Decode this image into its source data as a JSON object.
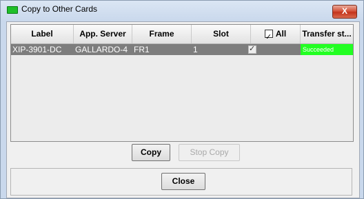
{
  "window": {
    "title": "Copy to Other Cards",
    "close_glyph": "X"
  },
  "table": {
    "columns": [
      {
        "label": "Label"
      },
      {
        "label": "App. Server"
      },
      {
        "label": "Frame"
      },
      {
        "label": "Slot"
      },
      {
        "label": "All",
        "has_checkbox": true,
        "checked": true
      },
      {
        "label": "Transfer st..."
      }
    ],
    "rows": [
      {
        "label": "XIP-3901-DC",
        "app_server": "GALLARDO-4",
        "frame": "FR1",
        "slot": "1",
        "selected": true,
        "transfer_status": "Succeeded"
      }
    ]
  },
  "buttons": {
    "copy": "Copy",
    "stop_copy": "Stop Copy",
    "close": "Close"
  },
  "colors": {
    "selected_row": "#7d7d7d",
    "status_success": "#22ff22",
    "title_icon": "#1fbf2a"
  },
  "icons": {
    "title": "green-card-icon",
    "window_close": "close-icon"
  }
}
